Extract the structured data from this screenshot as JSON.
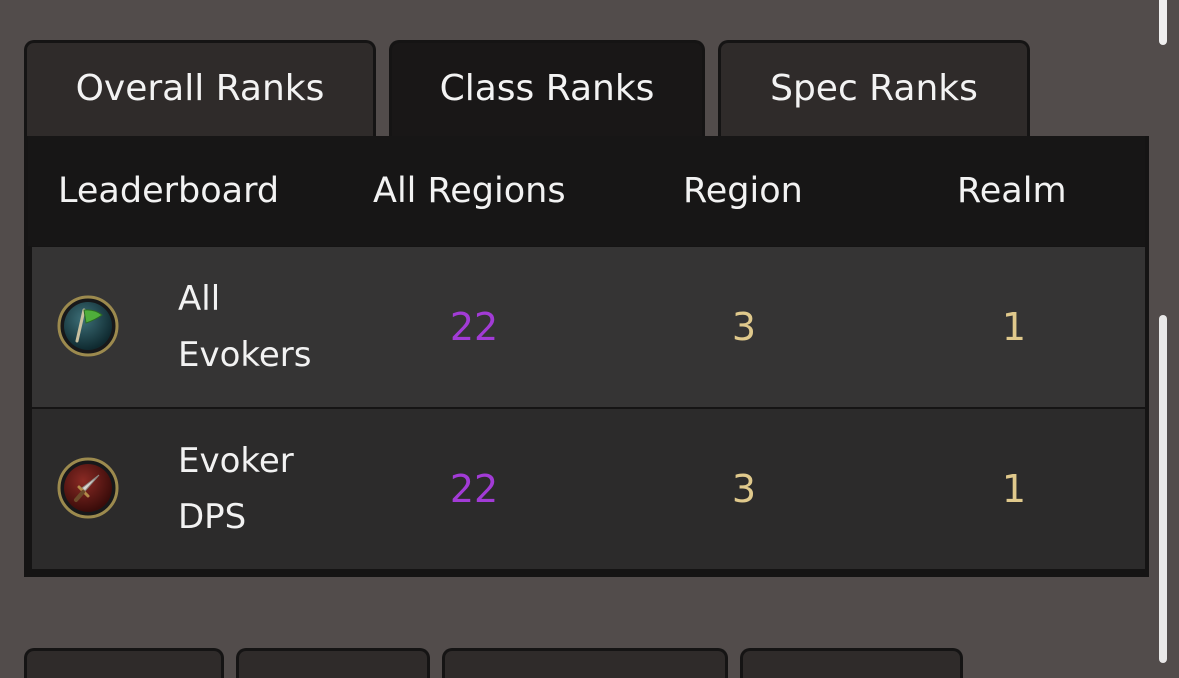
{
  "tabs": [
    {
      "label": "Overall Ranks",
      "active": false
    },
    {
      "label": "Class Ranks",
      "active": true
    },
    {
      "label": "Spec Ranks",
      "active": false
    }
  ],
  "table": {
    "headers": [
      "Leaderboard",
      "All Regions",
      "Region",
      "Realm"
    ],
    "rows": [
      {
        "label_line1": "All",
        "label_line2": "Evokers",
        "icon": "green-flag-icon",
        "all_regions": "22",
        "region": "3",
        "realm": "1"
      },
      {
        "label_line1": "Evoker",
        "label_line2": "DPS",
        "icon": "dagger-icon",
        "all_regions": "22",
        "region": "3",
        "realm": "1"
      }
    ]
  },
  "colors": {
    "background": "#524c4b",
    "rank_all_regions": "#a23bd6",
    "rank_region_realm": "#e0c98c"
  }
}
